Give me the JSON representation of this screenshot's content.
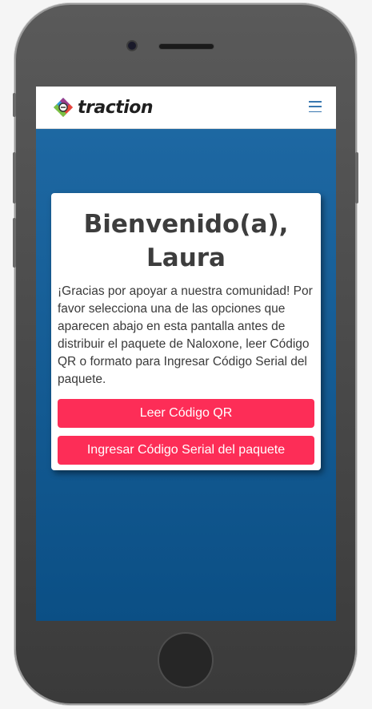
{
  "app": {
    "brand_name": "traction"
  },
  "navbar": {
    "logo_icon": "traction-logo-icon",
    "menu_icon": "hamburger-menu-icon"
  },
  "welcome_card": {
    "title": "Bienvenido(a), Laura",
    "message": "¡Gracias por apoyar a nuestra comunidad! Por favor selecciona una de las opciones que aparecen abajo en esta pantalla antes de distribuir el paquete de Naloxone, leer Código QR o formato para Ingresar Código Serial del paquete.",
    "buttons": {
      "scan_qr_label": "Leer Código QR",
      "enter_serial_label": "Ingresar Código Serial del paquete"
    }
  },
  "colors": {
    "primary_button": "#fd2d57",
    "screen_background_top": "#1f6aa5",
    "screen_background_bottom": "#0b4f85",
    "menu_icon": "#3a78b0"
  }
}
